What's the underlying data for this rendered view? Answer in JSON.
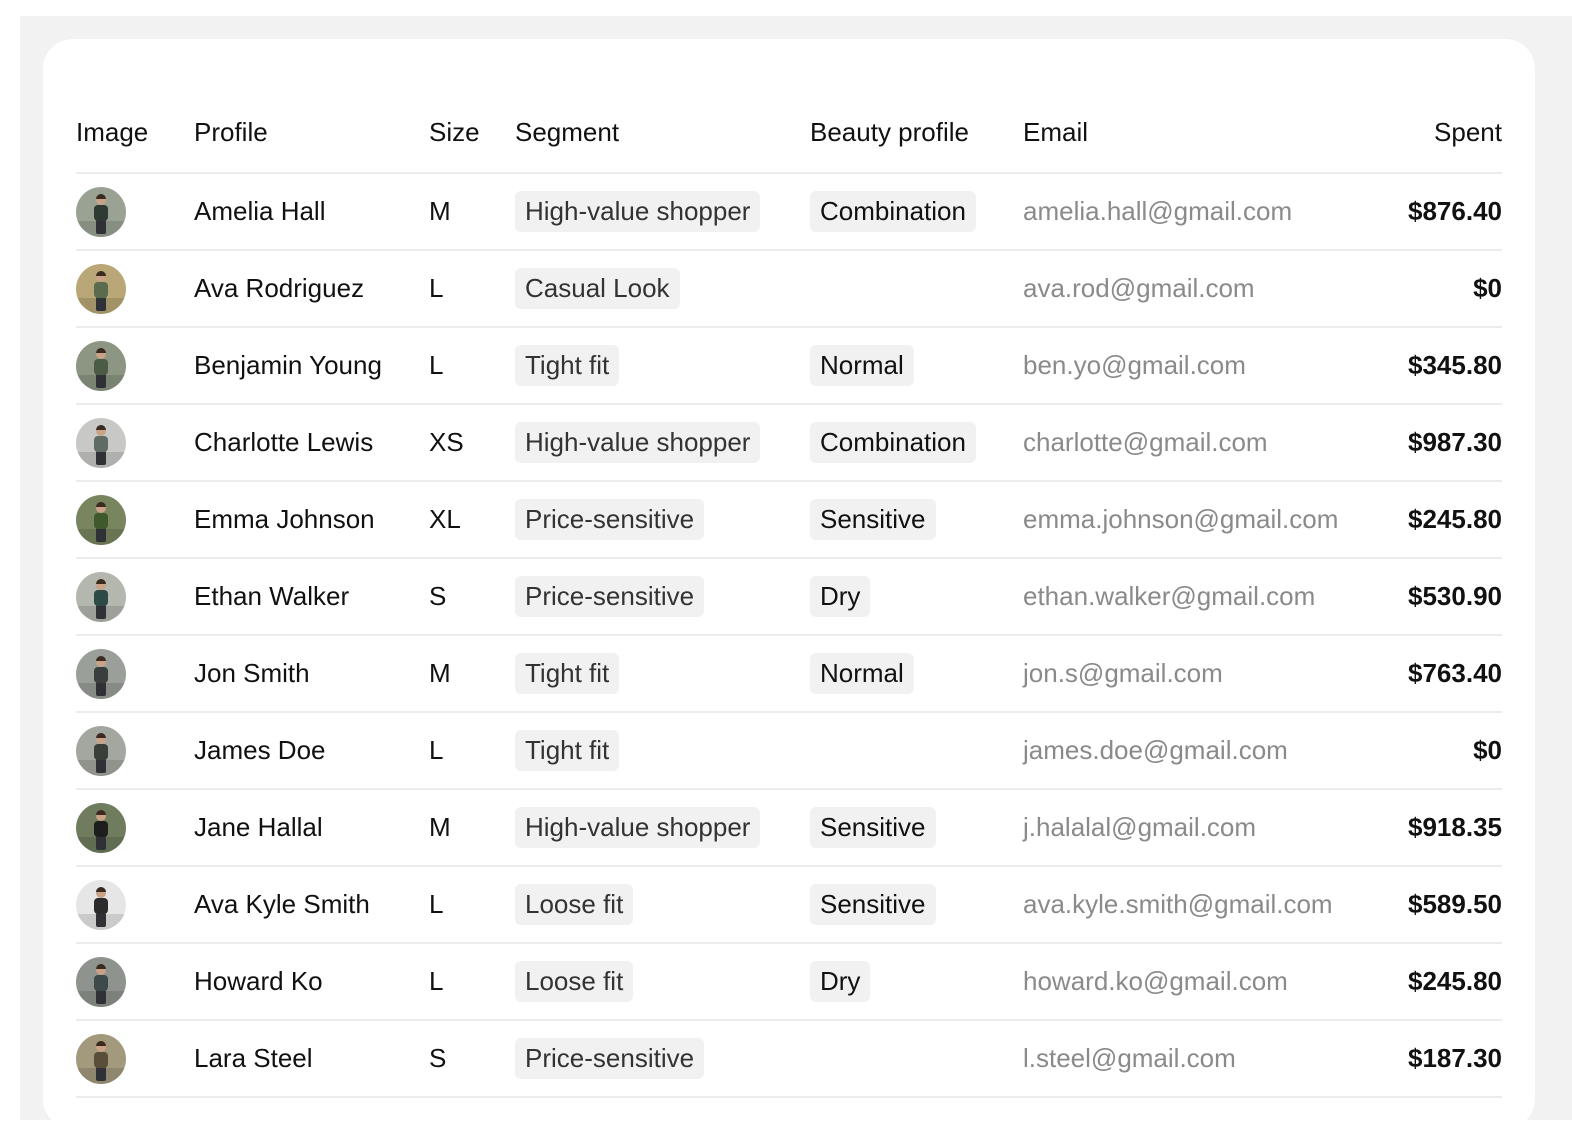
{
  "table": {
    "headers": {
      "image": "Image",
      "profile": "Profile",
      "size": "Size",
      "segment": "Segment",
      "beauty": "Beauty profile",
      "email": "Email",
      "spent": "Spent"
    },
    "rows": [
      {
        "name": "Amelia Hall",
        "size": "M",
        "segment": "High-value shopper",
        "beauty": "Combination",
        "email": "amelia.hall@gmail.com",
        "spent": "$876.40",
        "avatar_bg": "#9aa294",
        "avatar_shirt": "#2f3a34"
      },
      {
        "name": "Ava Rodriguez",
        "size": "L",
        "segment": "Casual Look",
        "beauty": "",
        "email": "ava.rod@gmail.com",
        "spent": "$0",
        "avatar_bg": "#b9a777",
        "avatar_shirt": "#5b6b4d"
      },
      {
        "name": "Benjamin Young",
        "size": "L",
        "segment": "Tight fit",
        "beauty": "Normal",
        "email": "ben.yo@gmail.com",
        "spent": "$345.80",
        "avatar_bg": "#8c9683",
        "avatar_shirt": "#4c5b46"
      },
      {
        "name": "Charlotte Lewis",
        "size": "XS",
        "segment": "High-value shopper",
        "beauty": "Combination",
        "email": "charlotte@gmail.com",
        "spent": "$987.30",
        "avatar_bg": "#c8c9c6",
        "avatar_shirt": "#5f6b65"
      },
      {
        "name": "Emma Johnson",
        "size": "XL",
        "segment": "Price-sensitive",
        "beauty": "Sensitive",
        "email": "emma.johnson@gmail.com",
        "spent": "$245.80",
        "avatar_bg": "#78855f",
        "avatar_shirt": "#3e5a2c"
      },
      {
        "name": "Ethan Walker",
        "size": "S",
        "segment": "Price-sensitive",
        "beauty": "Dry",
        "email": "ethan.walker@gmail.com",
        "spent": "$530.90",
        "avatar_bg": "#b3b7ae",
        "avatar_shirt": "#2d4a46"
      },
      {
        "name": "Jon Smith",
        "size": "M",
        "segment": "Tight fit",
        "beauty": "Normal",
        "email": "jon.s@gmail.com",
        "spent": "$763.40",
        "avatar_bg": "#9a9f99",
        "avatar_shirt": "#3a3f3d"
      },
      {
        "name": "James Doe",
        "size": "L",
        "segment": "Tight fit",
        "beauty": "",
        "email": "james.doe@gmail.com",
        "spent": "$0",
        "avatar_bg": "#a4a7a0",
        "avatar_shirt": "#3b3f3a"
      },
      {
        "name": "Jane Hallal",
        "size": "M",
        "segment": "High-value shopper",
        "beauty": "Sensitive",
        "email": "j.halalal@gmail.com",
        "spent": "$918.35",
        "avatar_bg": "#6f7d5e",
        "avatar_shirt": "#1e1e1e"
      },
      {
        "name": "Ava Kyle Smith",
        "size": "L",
        "segment": "Loose fit",
        "beauty": "Sensitive",
        "email": "ava.kyle.smith@gmail.com",
        "spent": "$589.50",
        "avatar_bg": "#e6e6e6",
        "avatar_shirt": "#2b2b2b"
      },
      {
        "name": "Howard Ko",
        "size": "L",
        "segment": "Loose fit",
        "beauty": "Dry",
        "email": "howard.ko@gmail.com",
        "spent": "$245.80",
        "avatar_bg": "#8f938e",
        "avatar_shirt": "#3d4a4a"
      },
      {
        "name": "Lara Steel",
        "size": "S",
        "segment": "Price-sensitive",
        "beauty": "",
        "email": "l.steel@gmail.com",
        "spent": "$187.30",
        "avatar_bg": "#a39a7d",
        "avatar_shirt": "#5a4e3a"
      }
    ]
  }
}
